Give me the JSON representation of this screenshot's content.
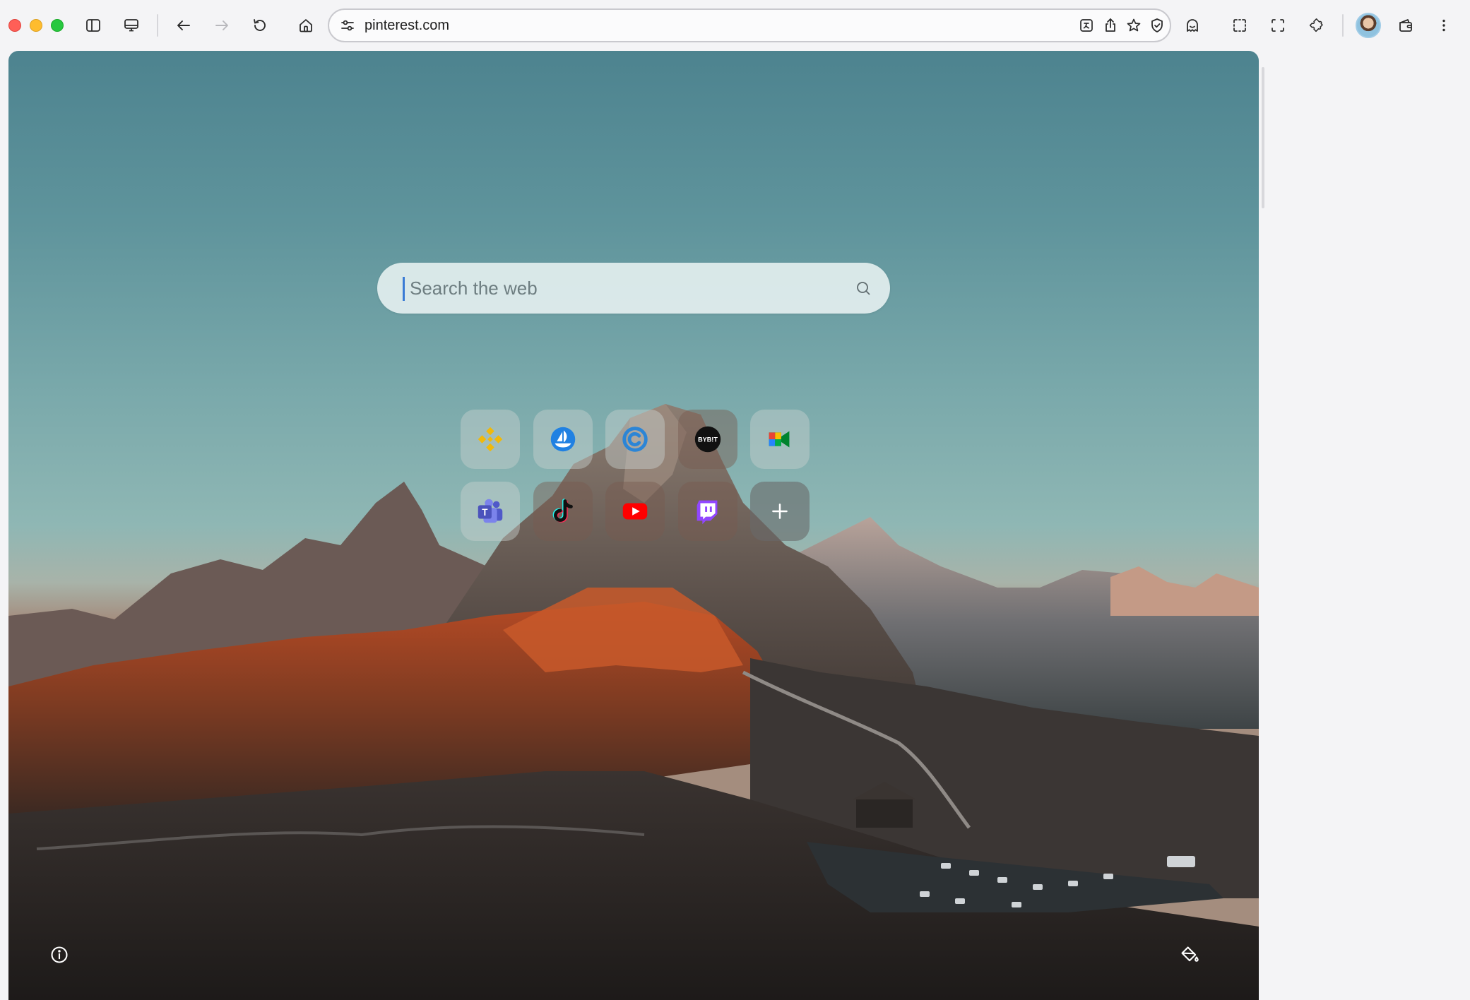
{
  "toolbar": {
    "url": "pinterest.com"
  },
  "newtab": {
    "search_placeholder": "Search the web"
  },
  "shortcuts": [
    {
      "name": "binance-icon",
      "color": "#f0b90b"
    },
    {
      "name": "opensea-icon",
      "color": "#2081e2"
    },
    {
      "name": "coinmarketcap-icon",
      "color": "#2c85d6"
    },
    {
      "name": "bybit-icon",
      "color": "#111111"
    },
    {
      "name": "google-meet-icon",
      "color": "#00897b"
    },
    {
      "name": "microsoft-teams-icon",
      "color": "#5059c9"
    },
    {
      "name": "tiktok-icon",
      "color": "#111111"
    },
    {
      "name": "youtube-icon",
      "color": "#ff0000"
    },
    {
      "name": "twitch-icon",
      "color": "#9146ff"
    },
    {
      "name": "add-shortcut-icon",
      "color": "#ffffff"
    }
  ],
  "bybit_label": "BYB!T"
}
